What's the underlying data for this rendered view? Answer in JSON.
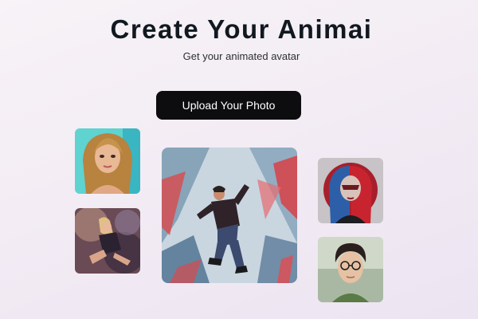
{
  "header": {
    "title": "Create Your Animai",
    "subtitle": "Get your animated avatar"
  },
  "actions": {
    "upload_label": "Upload Your Photo"
  },
  "gallery": {
    "images": [
      "portrait-blonde-woman-image",
      "dancing-woman-smoke-image",
      "dancing-man-abstract-image",
      "red-blue-hair-woman-image",
      "man-with-glasses-image"
    ]
  },
  "colors": {
    "button_bg": "#0d0d0f",
    "title": "#111820"
  }
}
